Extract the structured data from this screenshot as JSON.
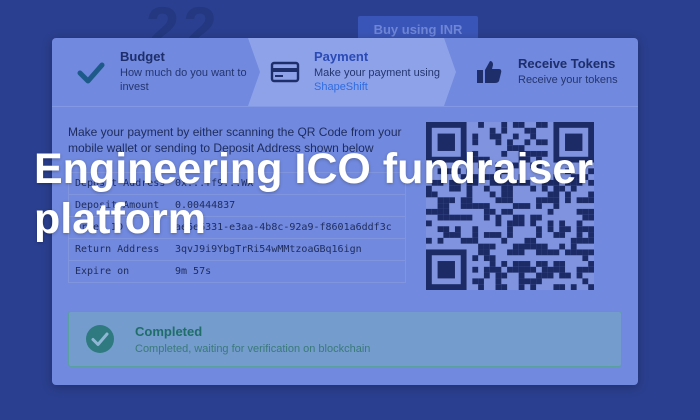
{
  "background": {
    "number": "22",
    "button_label": "Buy using INR"
  },
  "steps": [
    {
      "title": "Budget",
      "subtitle": "How much do you want to invest",
      "icon": "checkmark-icon"
    },
    {
      "title": "Payment",
      "subtitle_prefix": "Make your payment using ",
      "subtitle_link": "ShapeShift",
      "icon": "credit-card-icon"
    },
    {
      "title": "Receive Tokens",
      "subtitle": "Receive your tokens",
      "icon": "thumbs-up-icon"
    }
  ],
  "instructions": "Make your payment by either scanning the QR Code from your mobile wallet or sending to Deposit Address shown below",
  "details": [
    {
      "label": "Deposit Address",
      "value": "0x...ff9...WX"
    },
    {
      "label": "Deposit Amount",
      "value": "0.00444837"
    },
    {
      "label": "Order ID",
      "value": "ae6e6331-e3aa-4b8c-92a9-f8601a6ddf3c"
    },
    {
      "label": "Return Address",
      "value": "3qvJ9i9YbgTrRi54wMMtzoaGBq16ign"
    },
    {
      "label": "Expire on",
      "value": "9m 57s"
    }
  ],
  "status": {
    "title": "Completed",
    "subtitle": "Completed, waiting for verification on blockchain",
    "icon": "check-circle-icon"
  },
  "headline": "Engineering ICO fundraiser platform",
  "colors": {
    "background": "#2a3f8f",
    "card": "#7189de",
    "accent": "#2a4ab5",
    "success": "#1f6e6a",
    "qr": "#1c2a66"
  }
}
